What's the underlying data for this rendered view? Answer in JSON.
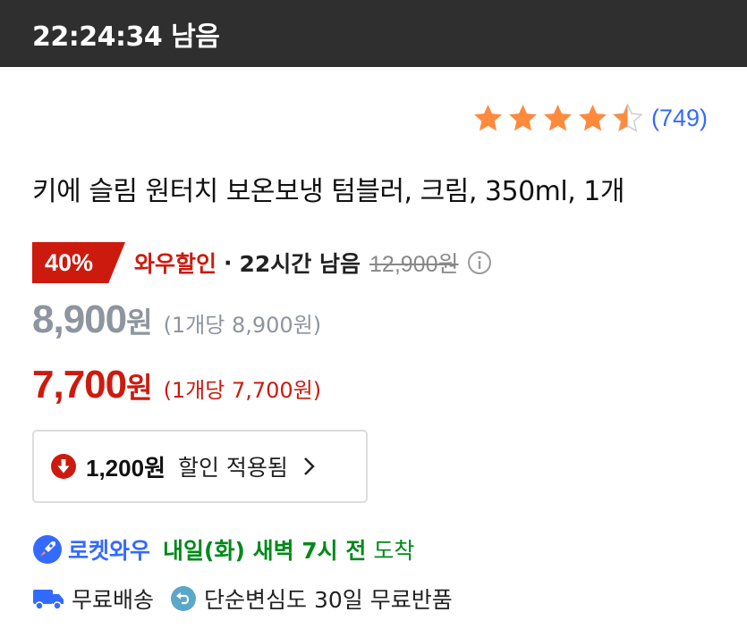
{
  "timer": {
    "text": "22:24:34 남음"
  },
  "rating": {
    "stars": 4.5,
    "max_stars": 5,
    "count_text": "(749)",
    "icon": "star-icon",
    "star_color": "#ff8a3d"
  },
  "product": {
    "title": "키에 슬림 원터치 보온보냉 텀블러, 크림, 350ml, 1개"
  },
  "discount": {
    "badge": "40%",
    "label": "와우할인",
    "separator": "·",
    "time_left": "22시간 남음",
    "original_price": "12,900원",
    "info_icon": "info-icon"
  },
  "price_regular": {
    "amount": "8,900",
    "won": "원",
    "unit": "(1개당 8,900원)"
  },
  "price_wow": {
    "amount": "7,700",
    "won": "원",
    "unit": "(1개당 7,700원)"
  },
  "coupon": {
    "icon": "arrow-down-circle-icon",
    "amount": "1,200원",
    "text": "할인 적용됨",
    "chevron": "chevron-right-icon"
  },
  "delivery": {
    "icon": "rocket-icon",
    "name": "로켓와우",
    "arrival": "내일(화) 새벽 7시 전",
    "suffix": "도착"
  },
  "shipping": {
    "truck_icon": "truck-icon",
    "free_shipping": "무료배송",
    "return_icon": "return-icon",
    "return_policy": "단순변심도 30일 무료반품"
  },
  "colors": {
    "accent_red": "#cc1b0e",
    "link_blue": "#346aff",
    "green": "#00891a",
    "gray_price": "#8e959e"
  }
}
